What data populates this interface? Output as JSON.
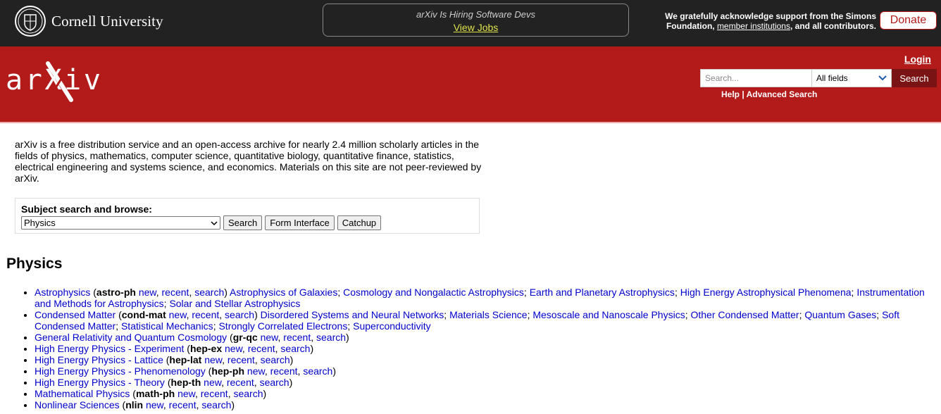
{
  "topbar": {
    "cornell_name": "Cornell University",
    "hiring_text": "arXiv Is Hiring Software Devs",
    "hiring_link": "View Jobs",
    "support_pre": "We gratefully acknowledge support from the Simons Foundation, ",
    "support_link": "member institutions",
    "support_post": ", and all contributors.",
    "donate_label": "Donate"
  },
  "header": {
    "logo_text": "arXiv",
    "login_label": "Login",
    "search_placeholder": "Search...",
    "field_selected": "All fields",
    "search_button": "Search",
    "help_label": "Help",
    "separator": " | ",
    "advanced_label": "Advanced Search"
  },
  "intro": "arXiv is a free distribution service and an open-access archive for nearly 2.4 million scholarly articles in the fields of physics, mathematics, computer science, quantitative biology, quantitative finance, statistics, electrical engineering and systems science, and economics. Materials on this site are not peer-reviewed by arXiv.",
  "subject": {
    "label": "Subject search and browse:",
    "selected": "Physics",
    "search_btn": "Search",
    "form_btn": "Form Interface",
    "catchup_btn": "Catchup"
  },
  "section_title": "Physics",
  "archives": [
    {
      "name": "Astrophysics",
      "code": "astro-ph",
      "links": [
        "new",
        "recent",
        "search"
      ],
      "subs": [
        "Astrophysics of Galaxies",
        "Cosmology and Nongalactic Astrophysics",
        "Earth and Planetary Astrophysics",
        "High Energy Astrophysical Phenomena",
        "Instrumentation and Methods for Astrophysics",
        "Solar and Stellar Astrophysics"
      ]
    },
    {
      "name": "Condensed Matter",
      "code": "cond-mat",
      "links": [
        "new",
        "recent",
        "search"
      ],
      "subs": [
        "Disordered Systems and Neural Networks",
        "Materials Science",
        "Mesoscale and Nanoscale Physics",
        "Other Condensed Matter",
        "Quantum Gases",
        "Soft Condensed Matter",
        "Statistical Mechanics",
        "Strongly Correlated Electrons",
        "Superconductivity"
      ]
    },
    {
      "name": "General Relativity and Quantum Cosmology",
      "code": "gr-qc",
      "links": [
        "new",
        "recent",
        "search"
      ],
      "subs": []
    },
    {
      "name": "High Energy Physics - Experiment",
      "code": "hep-ex",
      "links": [
        "new",
        "recent",
        "search"
      ],
      "subs": []
    },
    {
      "name": "High Energy Physics - Lattice",
      "code": "hep-lat",
      "links": [
        "new",
        "recent",
        "search"
      ],
      "subs": []
    },
    {
      "name": "High Energy Physics - Phenomenology",
      "code": "hep-ph",
      "links": [
        "new",
        "recent",
        "search"
      ],
      "subs": []
    },
    {
      "name": "High Energy Physics - Theory",
      "code": "hep-th",
      "links": [
        "new",
        "recent",
        "search"
      ],
      "subs": []
    },
    {
      "name": "Mathematical Physics",
      "code": "math-ph",
      "links": [
        "new",
        "recent",
        "search"
      ],
      "subs": []
    },
    {
      "name": "Nonlinear Sciences",
      "code": "nlin",
      "links": [
        "new",
        "recent",
        "search"
      ],
      "subs": []
    }
  ],
  "colors": {
    "brand_red": "#b31b1b",
    "dark_banner": "#222222",
    "link_blue": "#0000cc",
    "jobs_yellow": "#dfe24a"
  },
  "icons": [
    "cornell-seal-icon",
    "chevron-down-icon"
  ]
}
